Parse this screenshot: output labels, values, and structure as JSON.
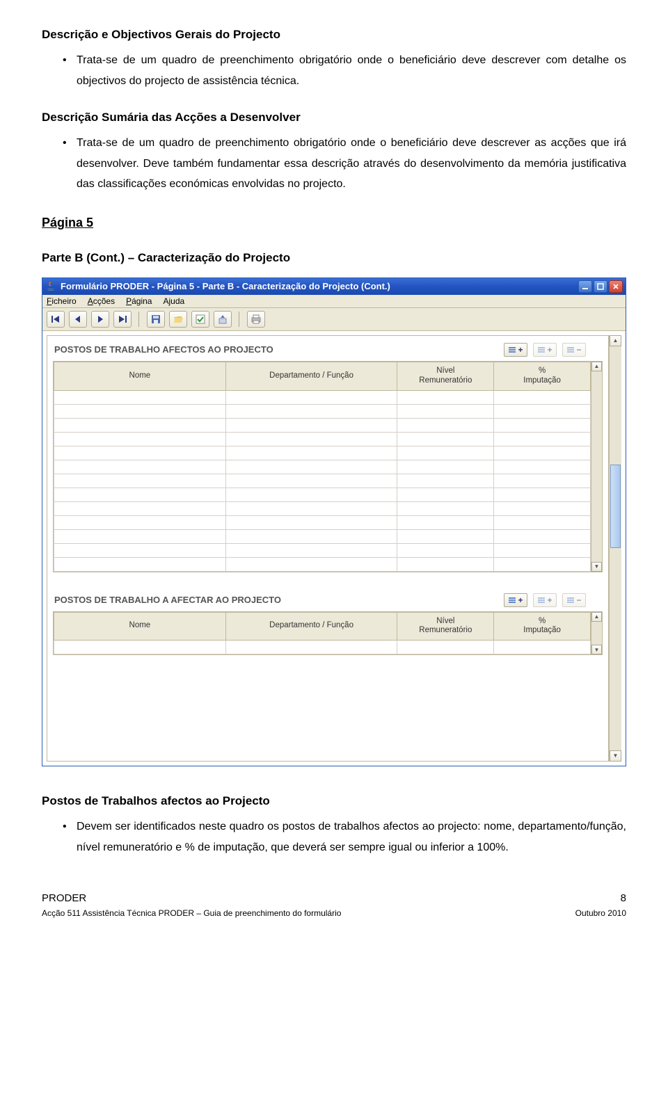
{
  "doc": {
    "section1": {
      "heading": "Descrição e Objectivos Gerais do Projecto",
      "bullet": "Trata-se de um quadro de preenchimento obrigatório onde o beneficiário deve descrever com detalhe os objectivos do projecto de assistência técnica."
    },
    "section2": {
      "heading": "Descrição Sumária das Acções a Desenvolver",
      "bullet": "Trata-se de um quadro de preenchimento obrigatório onde o beneficiário deve descrever as acções que irá desenvolver. Deve também fundamentar essa descrição através do desenvolvimento da memória justificativa das classificações económicas envolvidas no projecto."
    },
    "pageHeading": "Página 5",
    "subheading": "Parte B (Cont.) – Caracterização do Projecto",
    "section3": {
      "heading": "Postos de Trabalhos afectos ao Projecto",
      "bullet": "Devem ser identificados neste quadro os postos de trabalhos afectos ao projecto: nome, departamento/função, nível remuneratório e % de imputação, que deverá ser sempre igual ou inferior a 100%."
    },
    "footer": {
      "left": "PRODER",
      "pageNum": "8",
      "line": "Acção 511 Assistência Técnica PRODER – Guia de  preenchimento do formulário",
      "right": "Outubro 2010"
    }
  },
  "app": {
    "title": "Formulário PRODER - Página 5 - Parte B - Caracterização do Projecto (Cont.)",
    "menus": {
      "ficheiro": "Ficheiro",
      "accoes": "Acções",
      "pagina": "Página",
      "ajuda": "Ajuda"
    },
    "panel1": {
      "label": "POSTOS DE TRABALHO AFECTOS AO PROJECTO",
      "columns": {
        "nome": "Nome",
        "dep": "Departamento / Função",
        "nivel_l1": "Nível",
        "nivel_l2": "Remuneratório",
        "pct_l1": "%",
        "pct_l2": "Imputação"
      }
    },
    "panel2": {
      "label": "POSTOS DE TRABALHO A AFECTAR AO PROJECTO",
      "columns": {
        "nome": "Nome",
        "dep": "Departamento / Função",
        "nivel_l1": "Nível",
        "nivel_l2": "Remuneratório",
        "pct_l1": "%",
        "pct_l2": "Imputação"
      }
    }
  }
}
